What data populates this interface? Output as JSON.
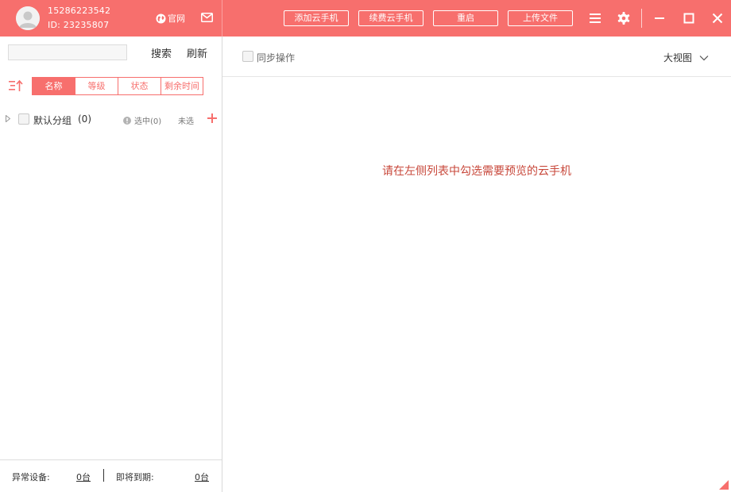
{
  "colors": {
    "brand": "#f76f6d",
    "hint": "#c8483b"
  },
  "user": {
    "phone": "15286223542",
    "id_label": "ID: 23235807"
  },
  "header": {
    "official_label": "官网",
    "buttons": {
      "add": "添加云手机",
      "renew": "续费云手机",
      "restart": "重启",
      "upload": "上传文件"
    },
    "icons": [
      "globe-icon",
      "mail-icon",
      "menu-icon",
      "gear-icon",
      "minimize-icon",
      "maximize-icon",
      "close-icon"
    ]
  },
  "sidebar": {
    "search": {
      "value": "",
      "placeholder": ""
    },
    "search_label": "搜索",
    "refresh_label": "刷新",
    "sort_tabs": [
      {
        "label": "名称",
        "active": true
      },
      {
        "label": "等级",
        "active": false
      },
      {
        "label": "状态",
        "active": false
      },
      {
        "label": "剩余时间",
        "active": false
      }
    ],
    "group": {
      "name": "默认分组",
      "count": "(0)",
      "selected": "选中(0)",
      "unselect": "未选"
    },
    "footer": {
      "abnormal_label": "异常设备:",
      "abnormal_value": "0台",
      "expiring_label": "即将到期:",
      "expiring_value": "0台"
    }
  },
  "main": {
    "sync_label": "同步操作",
    "view_mode": "大视图",
    "hint": "请在左侧列表中勾选需要预览的云手机"
  }
}
